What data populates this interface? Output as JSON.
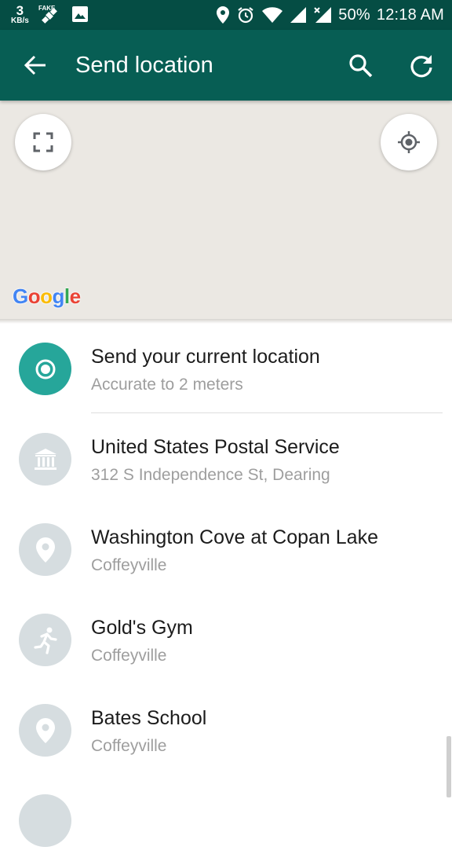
{
  "status_bar": {
    "speed_value": "3",
    "speed_unit": "KB/s",
    "battery": "50%",
    "time": "12:18 AM"
  },
  "app_bar": {
    "title": "Send location"
  },
  "map": {
    "attribution": "Google"
  },
  "list": {
    "items": [
      {
        "title": "Send your current location",
        "subtitle": "Accurate to 2 meters",
        "icon": "current-location-icon",
        "color": "#26a69a"
      },
      {
        "title": "United States Postal Service",
        "subtitle": "312 S Independence St, Dearing",
        "icon": "post-office-icon",
        "color": "#cfd8dc"
      },
      {
        "title": "Washington Cove at Copan Lake",
        "subtitle": "Coffeyville",
        "icon": "place-pin-icon",
        "color": "#cfd8dc"
      },
      {
        "title": "Gold's Gym",
        "subtitle": "Coffeyville",
        "icon": "gym-runner-icon",
        "color": "#cfd8dc"
      },
      {
        "title": "Bates School",
        "subtitle": "Coffeyville",
        "icon": "place-pin-icon",
        "color": "#cfd8dc"
      }
    ]
  },
  "colors": {
    "status_bar": "#054d44",
    "app_bar": "#075e54",
    "accent": "#26a69a",
    "map_bg": "#ebe8e3"
  }
}
